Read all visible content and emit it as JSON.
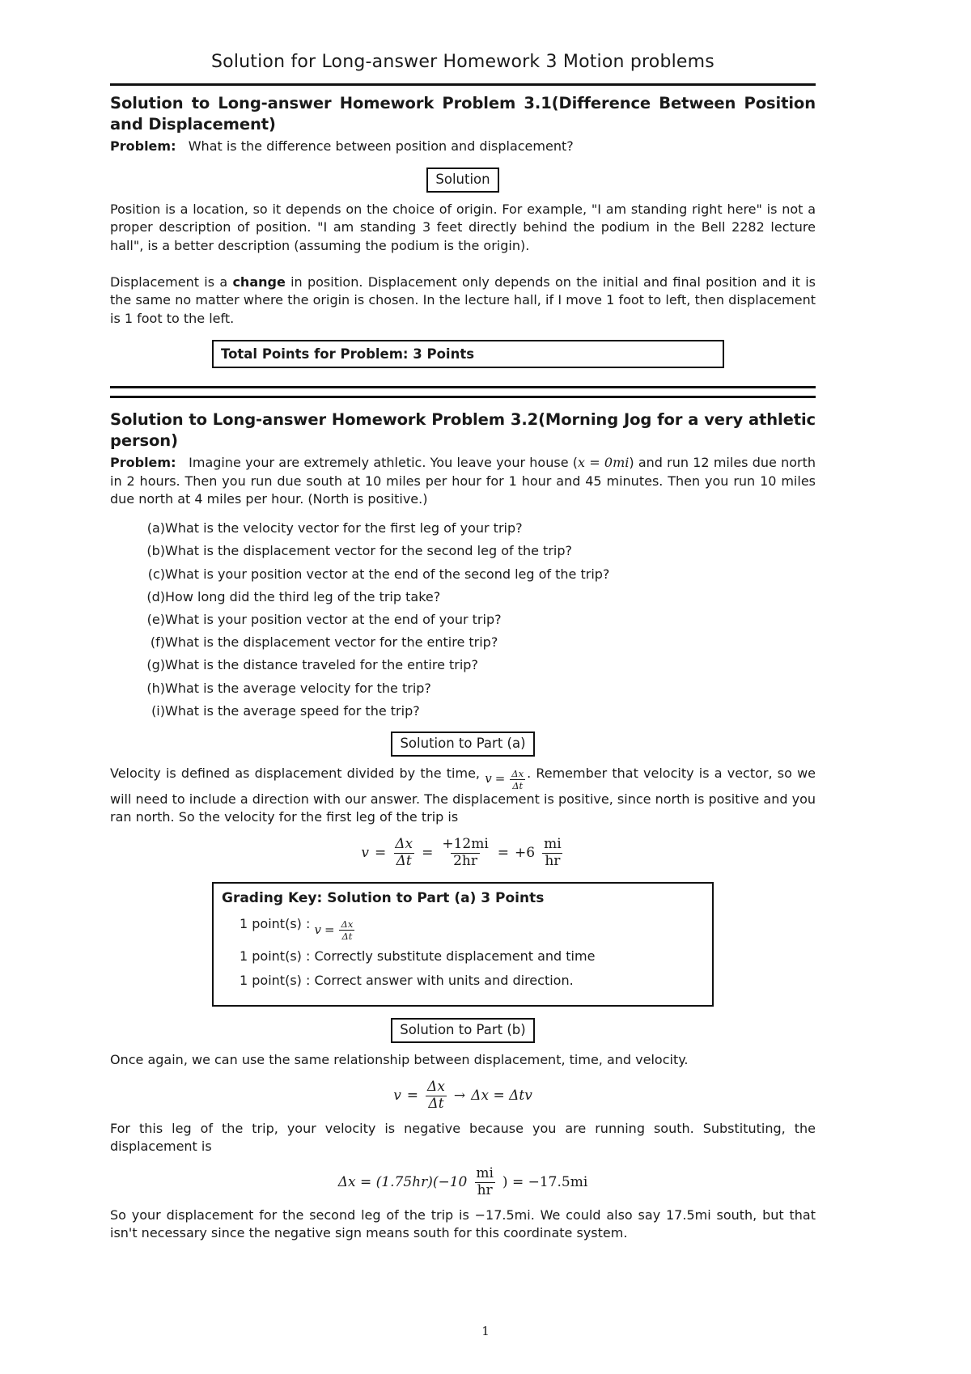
{
  "document": {
    "title": "Solution for Long-answer Homework 3 Motion problems",
    "page_number": "1"
  },
  "problem_31": {
    "heading": "Solution to Long-answer Homework Problem 3.1(Difference Between Position and Displacement)",
    "problem_label": "Problem:",
    "problem_text": "What is the difference between position and displacement?",
    "solution_box_label": "Solution",
    "paragraph_1": "Position is a location, so it depends on the choice of origin. For example, \"I am standing right here\" is not a proper description of position. \"I am standing 3 feet directly behind the podium in the Bell 2282 lecture hall\", is a better description (assuming the podium is the origin).",
    "paragraph_2_part1": "Displacement is a ",
    "paragraph_2_emph": "change",
    "paragraph_2_part2": " in position. Displacement only depends on the initial and final position and it is the same no matter where the origin is chosen. In the lecture hall, if I move 1 foot to left, then displacement is 1 foot to the left.",
    "total_points_label": "Total Points for Problem: 3 Points"
  },
  "problem_32": {
    "heading": "Solution to Long-answer Homework Problem 3.2(Morning Jog for a very athletic person)",
    "problem_label": "Problem:",
    "problem_text_1": "Imagine your are extremely athletic. You leave your house (",
    "problem_math_x": "x = 0mi",
    "problem_text_2": ") and run 12 miles due north in 2 hours. Then you run due south at 10 miles per hour for 1 hour and 45 minutes. Then you run 10 miles due north at 4 miles per hour. (North is positive.)",
    "questions": [
      {
        "label": "(a)",
        "text": "What is the velocity vector for the first leg of your trip?"
      },
      {
        "label": "(b)",
        "text": "What is the displacement vector for the second leg of the trip?"
      },
      {
        "label": "(c)",
        "text": "What is your position vector at the end of the second leg of the trip?"
      },
      {
        "label": "(d)",
        "text": "How long did the third leg of the trip take?"
      },
      {
        "label": "(e)",
        "text": "What is your position vector at the end of your trip?"
      },
      {
        "label": "(f)",
        "text": "What is the displacement vector for the entire trip?"
      },
      {
        "label": "(g)",
        "text": "What is the distance traveled for the entire trip?"
      },
      {
        "label": "(h)",
        "text": "What is the average velocity for the trip?"
      },
      {
        "label": "(i)",
        "text": "What is the average speed for the trip?"
      }
    ]
  },
  "part_a": {
    "box_label": "Solution to Part (a)",
    "text_before_math": "Velocity is defined as displacement divided by the time,",
    "inline_v": "v",
    "inline_eq": "=",
    "inline_num": "Δx",
    "inline_den": "Δt",
    "text_after_math": ". Remember that velocity is a vector, so we will need to include a direction with our answer. The displacement is positive, since north is positive and you ran north. So the velocity for the first leg of the trip is",
    "equation": {
      "v": "v",
      "eq1": "=",
      "f1_num": "Δx",
      "f1_den": "Δt",
      "eq2": "=",
      "f2_num": "+12mi",
      "f2_den": "2hr",
      "eq3": "=",
      "result_coef": "+6",
      "result_num": "mi",
      "result_den": "hr"
    },
    "grading_title": "Grading Key: Solution to Part (a) 3 Points",
    "grading_items": [
      {
        "points": "1 point(s) :",
        "text_v": "v",
        "text_eq": "=",
        "num": "Δx",
        "den": "Δt",
        "text": ""
      },
      {
        "points": "1 point(s) :",
        "text": "Correctly substitute displacement and time"
      },
      {
        "points": "1 point(s) :",
        "text": "Correct answer with units and direction."
      }
    ]
  },
  "part_b": {
    "box_label": "Solution to Part (b)",
    "paragraph_1": "Once again, we can use the same relationship between displacement, time, and velocity.",
    "equation_1": {
      "v": "v",
      "eq1": "=",
      "f1_num": "Δx",
      "f1_den": "Δt",
      "arrow": "→",
      "rhs": "Δx = Δtv"
    },
    "paragraph_2": "For this leg of the trip, your velocity is negative because you are running south. Substituting, the displacement is",
    "equation_2": {
      "lhs": "Δx = (1.75hr)(−10",
      "num": "mi",
      "den": "hr",
      "rhs": ") = −17.5mi"
    },
    "paragraph_3": "So your displacement for the second leg of the trip is −17.5mi. We could also say 17.5mi south, but that isn't necessary since the negative sign means south for this coordinate system."
  }
}
